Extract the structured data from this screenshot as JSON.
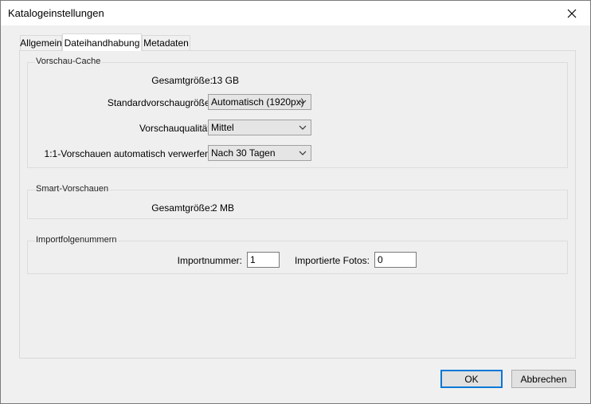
{
  "window": {
    "title": "Katalogeinstellungen"
  },
  "tabs": [
    {
      "label": "Allgemein"
    },
    {
      "label": "Dateihandhabung"
    },
    {
      "label": "Metadaten"
    }
  ],
  "preview_cache": {
    "title": "Vorschau-Cache",
    "total_size_label": "Gesamtgröße:",
    "total_size_value": "13 GB",
    "standard_size_label": "Standardvorschaugröße:",
    "standard_size_value": "Automatisch (1920px)",
    "quality_label": "Vorschauqualität:",
    "quality_value": "Mittel",
    "discard_label": "1:1-Vorschauen automatisch verwerfen:",
    "discard_value": "Nach 30 Tagen"
  },
  "smart_previews": {
    "title": "Smart-Vorschauen",
    "total_size_label": "Gesamtgröße:",
    "total_size_value": "2 MB"
  },
  "import_numbers": {
    "title": "Importfolgenummern",
    "import_number_label": "Importnummer:",
    "import_number_value": "1",
    "imported_photos_label": "Importierte Fotos:",
    "imported_photos_value": "0"
  },
  "footer": {
    "ok_label": "OK",
    "cancel_label": "Abbrechen"
  },
  "colors": {
    "accent": "#0078d7",
    "background": "#f0f0f0"
  },
  "icons": {
    "close": "close-icon",
    "dropdown": "chevron-down-icon"
  }
}
